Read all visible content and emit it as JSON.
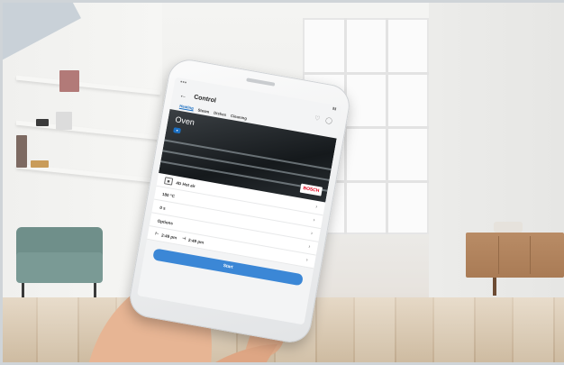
{
  "app": {
    "title": "Control",
    "tabs": [
      "Heating",
      "Steam",
      "Dishes",
      "Cleaning"
    ],
    "active_tab": "Heating"
  },
  "oven": {
    "label": "Oven",
    "brand": "BOSCH"
  },
  "settings": [
    {
      "label": "4D Hot air"
    },
    {
      "label": "180 °C"
    },
    {
      "label": "0 s"
    },
    {
      "label": "Options"
    }
  ],
  "schedule": {
    "start_time": "2:49 pm",
    "end_time": "2:49 pm"
  },
  "start_button": {
    "label": "Start"
  },
  "colors": {
    "accent": "#1b6fc2",
    "button": "#3b87d6",
    "brand_red": "#e2001a"
  },
  "icons": [
    "back-arrow-icon",
    "heart-icon",
    "bell-icon",
    "chevron-right-icon",
    "oven-mode-icon",
    "clock-icon"
  ]
}
